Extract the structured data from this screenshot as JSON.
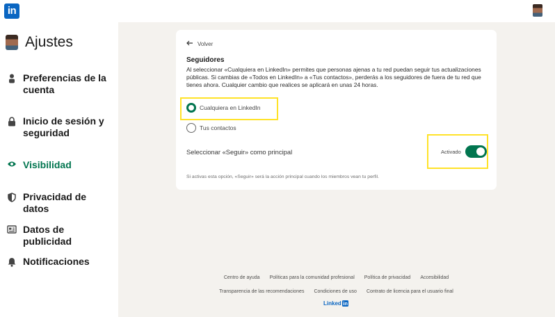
{
  "brand": {
    "logo_text": "in",
    "color": "#0a66c2"
  },
  "sidebar": {
    "title": "Ajustes",
    "accent": "#01754f",
    "items": [
      {
        "label": "Preferencias de la cuenta",
        "icon": "person-icon",
        "active": false
      },
      {
        "label": "Inicio de sesión y seguridad",
        "icon": "lock-icon",
        "active": false
      },
      {
        "label": "Visibilidad",
        "icon": "eye-icon",
        "active": true
      },
      {
        "label": "Privacidad de datos",
        "icon": "shield-icon",
        "active": false
      },
      {
        "label": "Datos de publicidad",
        "icon": "newspaper-icon",
        "active": false
      },
      {
        "label": "Notificaciones",
        "icon": "bell-icon",
        "active": false
      }
    ]
  },
  "card": {
    "back_label": "Volver",
    "heading": "Seguidores",
    "description": "Al seleccionar «Cualquiera en LinkedIn» permites que personas ajenas a tu red puedan seguir tus actualizaciones públicas. Si cambias de «Todos en LinkedIn» a «Tus contactos», perderás a los seguidores de fuera de tu red que tienes ahora. Cualquier cambio que realices se aplicará en unas 24 horas.",
    "options": [
      {
        "label": "Cualquiera en LinkedIn",
        "selected": true
      },
      {
        "label": "Tus contactos",
        "selected": false
      }
    ],
    "follow_label": "Seleccionar «Seguir» como principal",
    "toggle_label": "Activado",
    "toggle_on": true,
    "note": "Si activas esta opción, «Seguir» será la acción principal cuando los miembros vean tu perfil."
  },
  "footer": {
    "row1": [
      "Centro de ayuda",
      "Políticas para la comunidad profesional",
      "Política de privacidad",
      "Accesibilidad"
    ],
    "row2": [
      "Transparencia de las recomendaciones",
      "Condiciones de uso",
      "Contrato de licencia para el usuario final"
    ],
    "logo_word": "Linked",
    "logo_in": "in"
  },
  "highlight_color": "#ffe227"
}
